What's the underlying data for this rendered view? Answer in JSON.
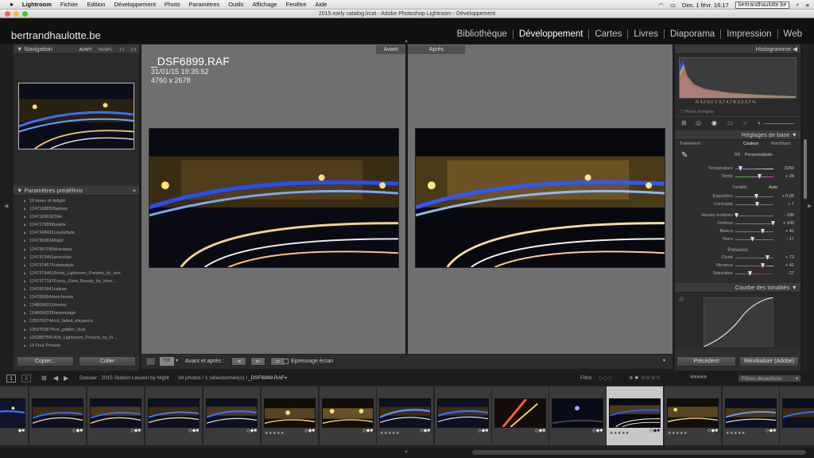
{
  "menubar": {
    "apple": "",
    "app": "Lightroom",
    "items": [
      "Fichier",
      "Edition",
      "Développement",
      "Photo",
      "Paramètres",
      "Outils",
      "Affichage",
      "Fenêtre",
      "Aide"
    ],
    "datetime": "Dim. 1 févr. 16:17",
    "host": "bertrandhaulotte.be"
  },
  "window": {
    "title": "2015 early catalog.lrcat - Adobe Photoshop Lightroom - Développement"
  },
  "identity": {
    "brand": "bertrandhaulotte.be",
    "modules": [
      "Bibliothèque",
      "Développement",
      "Cartes",
      "Livres",
      "Diaporama",
      "Impression",
      "Web"
    ],
    "active_module": "Développement"
  },
  "navigator": {
    "title": "Navigation",
    "options": [
      "ADAPT.",
      "REMPL.",
      "1:1",
      "1:3"
    ]
  },
  "presets": {
    "title": "Paramètres prédéfinis",
    "items": [
      "10 tones of delight",
      "1247168850fashion",
      "1247169618Tide",
      "1247170858prairie",
      "1247348431Lovelyfade",
      "1247356824frigid",
      "1247357290blueaqua",
      "1247372491porcelain",
      "1247374575urbanstyle",
      "1247376461Snow_Lightroom_Presets_by_vert",
      "1247377187Fuzzy_Glow_Beauty_by_shoc…",
      "1247803941caltran",
      "1247806564retchrome",
      "1248096012drama",
      "1248096333newvintage",
      "1253762744col_faded_elegance",
      "1253763874col_golden_dust",
      "1253897581499_Lightroom_Presets_by_N…",
      "14 Free Presets"
    ],
    "copy_label": "Copier...",
    "paste_label": "Coller"
  },
  "viewer": {
    "before_label": "Avant",
    "after_label": "Après",
    "filename": "_DSF6899.RAF",
    "datetime": "31/01/15 19:35:52",
    "dimensions": "4760 x 2678"
  },
  "toolbar": {
    "yy": "Y|Y",
    "before_after_label": "Avant et après :",
    "softproof_label": "Epreuvage écran"
  },
  "histogram": {
    "title": "Histogramme",
    "readout": "R 4,2 6,0  V 3,7 4,7  B 2,3 3,7 %",
    "photo_original": "Photo d'origine"
  },
  "basic": {
    "title": "Réglages de base",
    "treatment_label": "Traitement :",
    "color_label": "Couleur",
    "bw_label": "Noir/blanc",
    "wb_label": "BB :",
    "wb_value": "Personnalisée",
    "temp_label": "Température",
    "temp_value": "3150",
    "tint_label": "Teinte",
    "tint_value": "+ 28",
    "tone_label": "Tonalité",
    "auto_label": "Auto",
    "exposure_label": "Exposition",
    "exposure_value": "+ 0,05",
    "contrast_label": "Contraste",
    "contrast_value": "+ 7",
    "highlights_label": "Hautes lumières",
    "highlights_value": "- 100",
    "shadows_label": "Ombres",
    "shadows_value": "+ 100",
    "whites_label": "Blancs",
    "whites_value": "+ 41",
    "blacks_label": "Noirs",
    "blacks_value": "- 17",
    "presence_label": "Présence",
    "clarity_label": "Clarté",
    "clarity_value": "+ 73",
    "vibrance_label": "Vibrance",
    "vibrance_value": "+ 41",
    "saturation_label": "Saturation",
    "saturation_value": "- 27"
  },
  "tonecurve": {
    "title": "Courbe des tonalités"
  },
  "right_buttons": {
    "previous": "Précédent",
    "reset": "Réinitialiser (Adobe)"
  },
  "filmbar": {
    "page1": "1",
    "page2": "2",
    "folder": "Dossier : 2015 Station Leuven by Night",
    "count": "34 photos / 1 sélectionnée(s) /",
    "current": "_DSF6899.RAF",
    "filter_label": "Filtre :",
    "filter_state": "Filtres désactivés"
  },
  "filmstrip": {
    "stars": "★★★★★"
  }
}
